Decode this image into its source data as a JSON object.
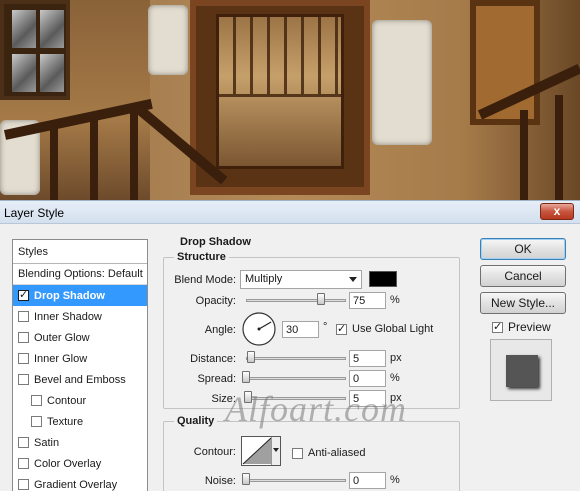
{
  "window": {
    "title": "Layer Style",
    "close_glyph": "x"
  },
  "styles_list": {
    "header": "Styles",
    "blending_options": "Blending Options: Default",
    "items": [
      {
        "label": "Drop Shadow",
        "checked": true,
        "selected": true,
        "sub": false
      },
      {
        "label": "Inner Shadow",
        "checked": false,
        "selected": false,
        "sub": false
      },
      {
        "label": "Outer Glow",
        "checked": false,
        "selected": false,
        "sub": false
      },
      {
        "label": "Inner Glow",
        "checked": false,
        "selected": false,
        "sub": false
      },
      {
        "label": "Bevel and Emboss",
        "checked": false,
        "selected": false,
        "sub": false
      },
      {
        "label": "Contour",
        "checked": false,
        "selected": false,
        "sub": true
      },
      {
        "label": "Texture",
        "checked": false,
        "selected": false,
        "sub": true
      },
      {
        "label": "Satin",
        "checked": false,
        "selected": false,
        "sub": false
      },
      {
        "label": "Color Overlay",
        "checked": false,
        "selected": false,
        "sub": false
      },
      {
        "label": "Gradient Overlay",
        "checked": false,
        "selected": false,
        "sub": false
      }
    ]
  },
  "drop_shadow": {
    "title": "Drop Shadow",
    "structure": {
      "title": "Structure",
      "blend_mode_label": "Blend Mode:",
      "blend_mode_value": "Multiply",
      "shadow_color": "#000000",
      "opacity_label": "Opacity:",
      "opacity_value": "75",
      "opacity_unit": "%",
      "opacity_fraction": 0.75,
      "angle_label": "Angle:",
      "angle_value": "30",
      "angle_unit": "°",
      "use_global_light_label": "Use Global Light",
      "use_global_light": true,
      "distance_label": "Distance:",
      "distance_value": "5",
      "distance_unit": "px",
      "spread_label": "Spread:",
      "spread_value": "0",
      "spread_unit": "%",
      "size_label": "Size:",
      "size_value": "5",
      "size_unit": "px"
    },
    "quality": {
      "title": "Quality",
      "contour_label": "Contour:",
      "anti_aliased_label": "Anti-aliased",
      "anti_aliased": false,
      "noise_label": "Noise:",
      "noise_value": "0",
      "noise_unit": "%"
    }
  },
  "buttons": {
    "ok": "OK",
    "cancel": "Cancel",
    "new_style": "New Style...",
    "preview_label": "Preview",
    "preview": true
  },
  "watermark": "Alfoart.com"
}
